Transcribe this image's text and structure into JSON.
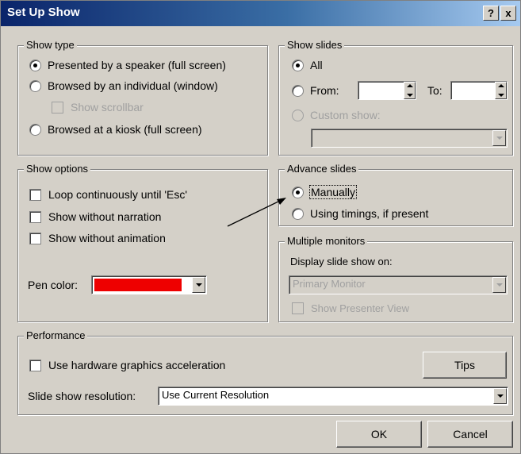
{
  "window": {
    "title": "Set Up Show",
    "help_label": "?",
    "close_label": "x"
  },
  "show_type": {
    "legend": "Show type",
    "presented_label": "Presented by a speaker (full screen)",
    "browsed_individual_label": "Browsed by an individual (window)",
    "show_scrollbar_label": "Show scrollbar",
    "browsed_kiosk_label": "Browsed at a kiosk (full screen)",
    "selected": "Presented by a speaker (full screen)"
  },
  "show_slides": {
    "legend": "Show slides",
    "all_label": "All",
    "from_label": "From:",
    "to_label": "To:",
    "from_value": "",
    "to_value": "",
    "custom_show_label": "Custom show:",
    "custom_show_value": "",
    "selected": "All"
  },
  "show_options": {
    "legend": "Show options",
    "loop_label": "Loop continuously until 'Esc'",
    "without_narration_label": "Show without narration",
    "without_animation_label": "Show without animation",
    "pen_color_label": "Pen color:",
    "pen_color": "#ee0000"
  },
  "advance_slides": {
    "legend": "Advance slides",
    "manually_label": "Manually",
    "timings_label": "Using timings, if present",
    "selected": "Manually"
  },
  "multiple_monitors": {
    "legend": "Multiple monitors",
    "display_on_label": "Display slide show on:",
    "monitor_value": "Primary Monitor",
    "presenter_view_label": "Show Presenter View"
  },
  "performance": {
    "legend": "Performance",
    "hw_accel_label": "Use hardware graphics acceleration",
    "tips_label": "Tips",
    "resolution_label": "Slide show resolution:",
    "resolution_value": "Use Current Resolution"
  },
  "footer": {
    "ok_label": "OK",
    "cancel_label": "Cancel"
  }
}
